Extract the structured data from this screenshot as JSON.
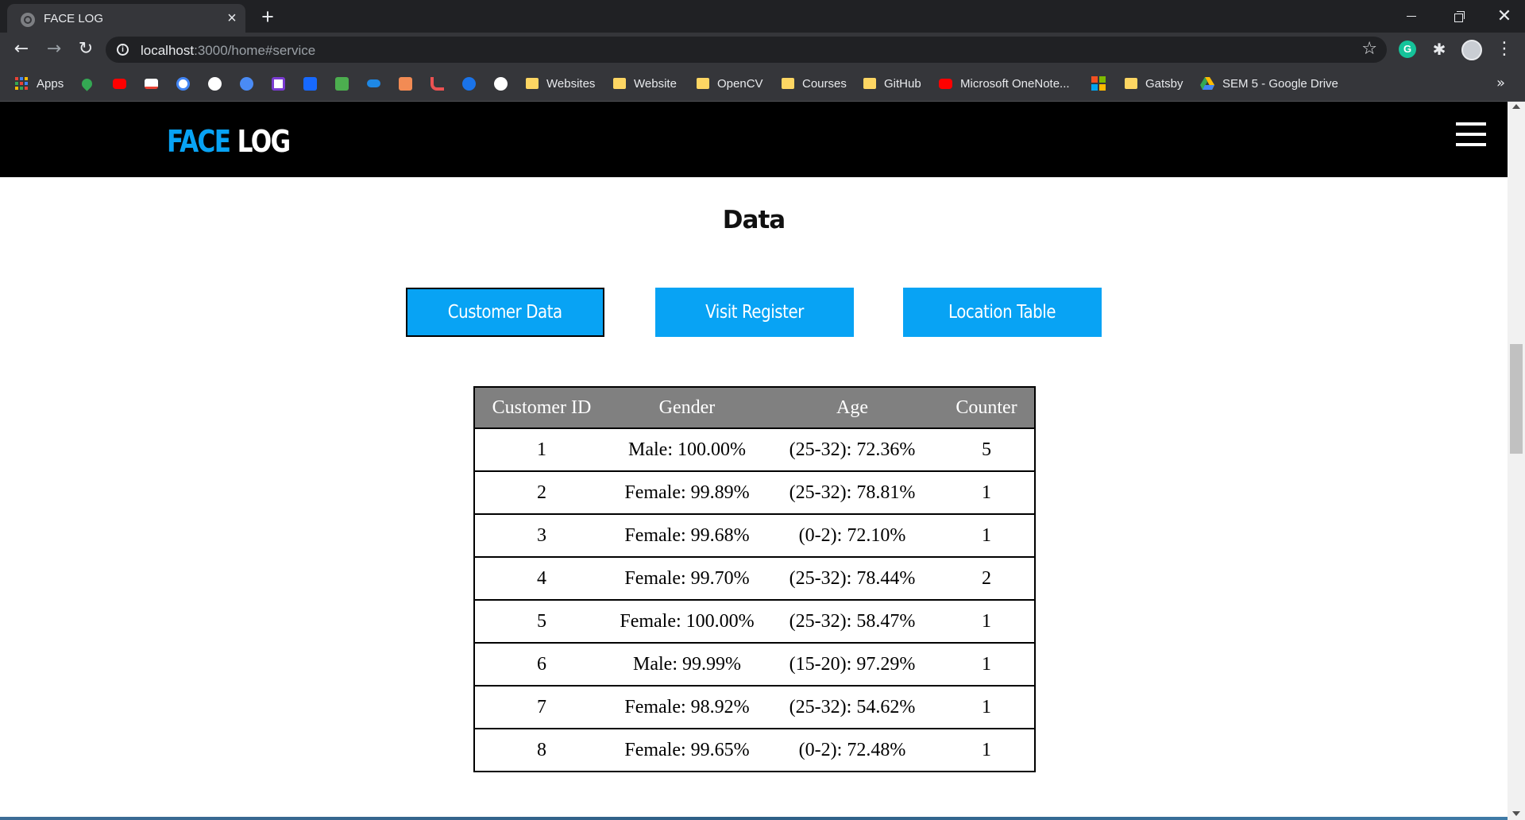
{
  "browser": {
    "tab_title": "FACE LOG",
    "tab_close": "×",
    "new_tab": "+",
    "url_host": "localhost",
    "url_path": ":3000/home#service",
    "bookmarks": {
      "apps": "Apps",
      "websites": "Websites",
      "website": "Website",
      "opencv": "OpenCV",
      "courses": "Courses",
      "github": "GitHub",
      "onenote": "Microsoft OneNote...",
      "gatsby": "Gatsby",
      "sem5": "SEM 5 - Google Drive",
      "more": "»"
    }
  },
  "header": {
    "logo_part1": "FACE",
    "logo_part2": "LOG"
  },
  "main": {
    "title": "Data",
    "buttons": {
      "customer_data": "Customer Data",
      "visit_register": "Visit Register",
      "location_table": "Location Table"
    },
    "table": {
      "headers": [
        "Customer ID",
        "Gender",
        "Age",
        "Counter"
      ],
      "rows": [
        [
          "1",
          "Male: 100.00%",
          "(25-32): 72.36%",
          "5"
        ],
        [
          "2",
          "Female: 99.89%",
          "(25-32): 78.81%",
          "1"
        ],
        [
          "3",
          "Female: 99.68%",
          "(0-2): 72.10%",
          "1"
        ],
        [
          "4",
          "Female: 99.70%",
          "(25-32): 78.44%",
          "2"
        ],
        [
          "5",
          "Female: 100.00%",
          "(25-32): 58.47%",
          "1"
        ],
        [
          "6",
          "Male: 99.99%",
          "(15-20): 97.29%",
          "1"
        ],
        [
          "7",
          "Female: 98.92%",
          "(25-32): 54.62%",
          "1"
        ],
        [
          "8",
          "Female: 99.65%",
          "(0-2): 72.48%",
          "1"
        ]
      ]
    }
  },
  "colors": {
    "accent": "#08a3f4",
    "header_bg": "#000000",
    "table_header_bg": "#808080"
  }
}
